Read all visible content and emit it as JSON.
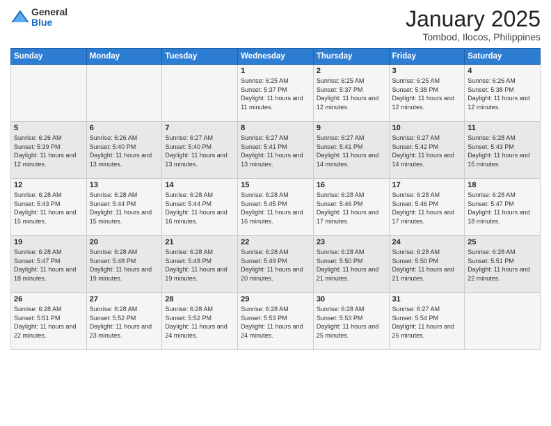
{
  "logo": {
    "general": "General",
    "blue": "Blue"
  },
  "title": "January 2025",
  "subtitle": "Tombod, Ilocos, Philippines",
  "days": [
    "Sunday",
    "Monday",
    "Tuesday",
    "Wednesday",
    "Thursday",
    "Friday",
    "Saturday"
  ],
  "weeks": [
    [
      {
        "day": "",
        "info": ""
      },
      {
        "day": "",
        "info": ""
      },
      {
        "day": "",
        "info": ""
      },
      {
        "day": "1",
        "info": "Sunrise: 6:25 AM\nSunset: 5:37 PM\nDaylight: 11 hours\nand 11 minutes."
      },
      {
        "day": "2",
        "info": "Sunrise: 6:25 AM\nSunset: 5:37 PM\nDaylight: 11 hours\nand 12 minutes."
      },
      {
        "day": "3",
        "info": "Sunrise: 6:25 AM\nSunset: 5:38 PM\nDaylight: 11 hours\nand 12 minutes."
      },
      {
        "day": "4",
        "info": "Sunrise: 6:26 AM\nSunset: 5:38 PM\nDaylight: 11 hours\nand 12 minutes."
      }
    ],
    [
      {
        "day": "5",
        "info": "Sunrise: 6:26 AM\nSunset: 5:39 PM\nDaylight: 11 hours\nand 12 minutes."
      },
      {
        "day": "6",
        "info": "Sunrise: 6:26 AM\nSunset: 5:40 PM\nDaylight: 11 hours\nand 13 minutes."
      },
      {
        "day": "7",
        "info": "Sunrise: 6:27 AM\nSunset: 5:40 PM\nDaylight: 11 hours\nand 13 minutes."
      },
      {
        "day": "8",
        "info": "Sunrise: 6:27 AM\nSunset: 5:41 PM\nDaylight: 11 hours\nand 13 minutes."
      },
      {
        "day": "9",
        "info": "Sunrise: 6:27 AM\nSunset: 5:41 PM\nDaylight: 11 hours\nand 14 minutes."
      },
      {
        "day": "10",
        "info": "Sunrise: 6:27 AM\nSunset: 5:42 PM\nDaylight: 11 hours\nand 14 minutes."
      },
      {
        "day": "11",
        "info": "Sunrise: 6:28 AM\nSunset: 5:43 PM\nDaylight: 11 hours\nand 15 minutes."
      }
    ],
    [
      {
        "day": "12",
        "info": "Sunrise: 6:28 AM\nSunset: 5:43 PM\nDaylight: 11 hours\nand 15 minutes."
      },
      {
        "day": "13",
        "info": "Sunrise: 6:28 AM\nSunset: 5:44 PM\nDaylight: 11 hours\nand 15 minutes."
      },
      {
        "day": "14",
        "info": "Sunrise: 6:28 AM\nSunset: 5:44 PM\nDaylight: 11 hours\nand 16 minutes."
      },
      {
        "day": "15",
        "info": "Sunrise: 6:28 AM\nSunset: 5:45 PM\nDaylight: 11 hours\nand 16 minutes."
      },
      {
        "day": "16",
        "info": "Sunrise: 6:28 AM\nSunset: 5:46 PM\nDaylight: 11 hours\nand 17 minutes."
      },
      {
        "day": "17",
        "info": "Sunrise: 6:28 AM\nSunset: 5:46 PM\nDaylight: 11 hours\nand 17 minutes."
      },
      {
        "day": "18",
        "info": "Sunrise: 6:28 AM\nSunset: 5:47 PM\nDaylight: 11 hours\nand 18 minutes."
      }
    ],
    [
      {
        "day": "19",
        "info": "Sunrise: 6:28 AM\nSunset: 5:47 PM\nDaylight: 11 hours\nand 18 minutes."
      },
      {
        "day": "20",
        "info": "Sunrise: 6:28 AM\nSunset: 5:48 PM\nDaylight: 11 hours\nand 19 minutes."
      },
      {
        "day": "21",
        "info": "Sunrise: 6:28 AM\nSunset: 5:48 PM\nDaylight: 11 hours\nand 19 minutes."
      },
      {
        "day": "22",
        "info": "Sunrise: 6:28 AM\nSunset: 5:49 PM\nDaylight: 11 hours\nand 20 minutes."
      },
      {
        "day": "23",
        "info": "Sunrise: 6:28 AM\nSunset: 5:50 PM\nDaylight: 11 hours\nand 21 minutes."
      },
      {
        "day": "24",
        "info": "Sunrise: 6:28 AM\nSunset: 5:50 PM\nDaylight: 11 hours\nand 21 minutes."
      },
      {
        "day": "25",
        "info": "Sunrise: 6:28 AM\nSunset: 5:51 PM\nDaylight: 11 hours\nand 22 minutes."
      }
    ],
    [
      {
        "day": "26",
        "info": "Sunrise: 6:28 AM\nSunset: 5:51 PM\nDaylight: 11 hours\nand 22 minutes."
      },
      {
        "day": "27",
        "info": "Sunrise: 6:28 AM\nSunset: 5:52 PM\nDaylight: 11 hours\nand 23 minutes."
      },
      {
        "day": "28",
        "info": "Sunrise: 6:28 AM\nSunset: 5:52 PM\nDaylight: 11 hours\nand 24 minutes."
      },
      {
        "day": "29",
        "info": "Sunrise: 6:28 AM\nSunset: 5:53 PM\nDaylight: 11 hours\nand 24 minutes."
      },
      {
        "day": "30",
        "info": "Sunrise: 6:28 AM\nSunset: 5:53 PM\nDaylight: 11 hours\nand 25 minutes."
      },
      {
        "day": "31",
        "info": "Sunrise: 6:27 AM\nSunset: 5:54 PM\nDaylight: 11 hours\nand 26 minutes."
      },
      {
        "day": "",
        "info": ""
      }
    ]
  ]
}
